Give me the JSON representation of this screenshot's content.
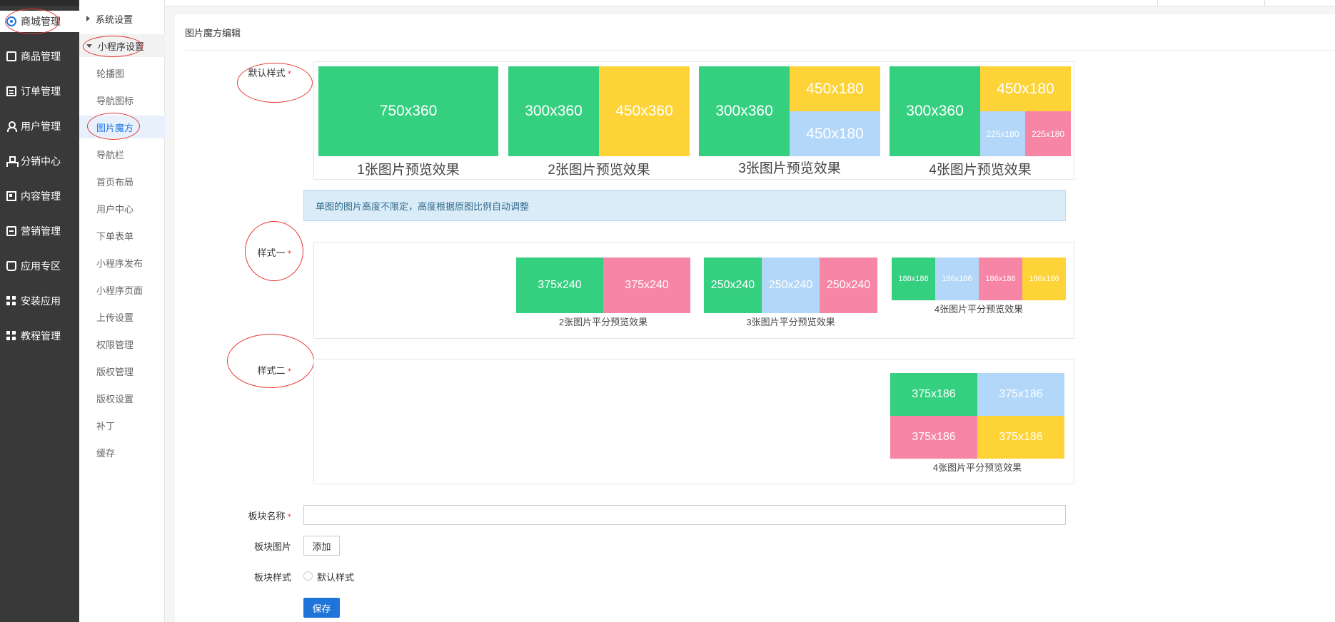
{
  "nav": {
    "items": [
      {
        "label": "商城管理",
        "icon": "mall-icon"
      },
      {
        "label": "商品管理",
        "icon": "goods-icon"
      },
      {
        "label": "订单管理",
        "icon": "order-icon"
      },
      {
        "label": "用户管理",
        "icon": "user-icon"
      },
      {
        "label": "分销中心",
        "icon": "distribution-icon"
      },
      {
        "label": "内容管理",
        "icon": "content-icon"
      },
      {
        "label": "营销管理",
        "icon": "marketing-icon"
      },
      {
        "label": "应用专区",
        "icon": "apps-icon"
      },
      {
        "label": "安装应用",
        "icon": "install-icon"
      },
      {
        "label": "教程管理",
        "icon": "tutorial-icon"
      }
    ]
  },
  "subnav": {
    "system_settings": "系统设置",
    "mini_program_settings": "小程序设置",
    "items": [
      "轮播图",
      "导航图标",
      "图片魔方",
      "导航栏",
      "首页布局",
      "用户中心",
      "下单表单",
      "小程序发布",
      "小程序页面",
      "上传设置",
      "权限管理",
      "版权管理",
      "版权设置",
      "补丁",
      "缓存"
    ]
  },
  "panel": {
    "title": "图片魔方编辑",
    "default_style_label": "默认样式",
    "style1_label": "样式一",
    "style2_label": "样式二",
    "alert_text": "单图的图片高度不限定，高度根据原图比例自动调整",
    "default_previews": {
      "p1": {
        "tile": "750x360",
        "caption": "1张图片预览效果"
      },
      "p2": {
        "tiles": [
          "300x360",
          "450x360"
        ],
        "caption": "2张图片预览效果"
      },
      "p3": {
        "tiles": [
          "300x360",
          "450x180",
          "450x180"
        ],
        "caption": "3张图片预览效果"
      },
      "p4": {
        "tiles": [
          "300x360",
          "450x180",
          "225x180",
          "225x180"
        ],
        "caption": "4张图片预览效果"
      }
    },
    "style1_previews": {
      "p2": {
        "tiles": [
          "375x240",
          "375x240"
        ],
        "caption": "2张图片平分预览效果"
      },
      "p3": {
        "tiles": [
          "250x240",
          "250x240",
          "250x240"
        ],
        "caption": "3张图片平分预览效果"
      },
      "p4": {
        "tiles": [
          "186x186",
          "186x186",
          "186x186",
          "186x186"
        ],
        "caption": "4张图片平分预览效果"
      }
    },
    "style2_preview": {
      "tiles": [
        "375x186",
        "375x186",
        "375x186",
        "375x186"
      ],
      "caption": "4张图片平分预览效果"
    },
    "block_name_label": "板块名称",
    "block_image_label": "板块图片",
    "add_button": "添加",
    "block_style_label": "板块样式",
    "radio_default": "默认样式",
    "save_button": "保存"
  },
  "colors": {
    "green": "#35cf80",
    "yellow": "#fdd338",
    "blue": "#b2d7f8",
    "pink": "#f785a5",
    "primary": "#1e74d8",
    "required": "#e53935"
  }
}
